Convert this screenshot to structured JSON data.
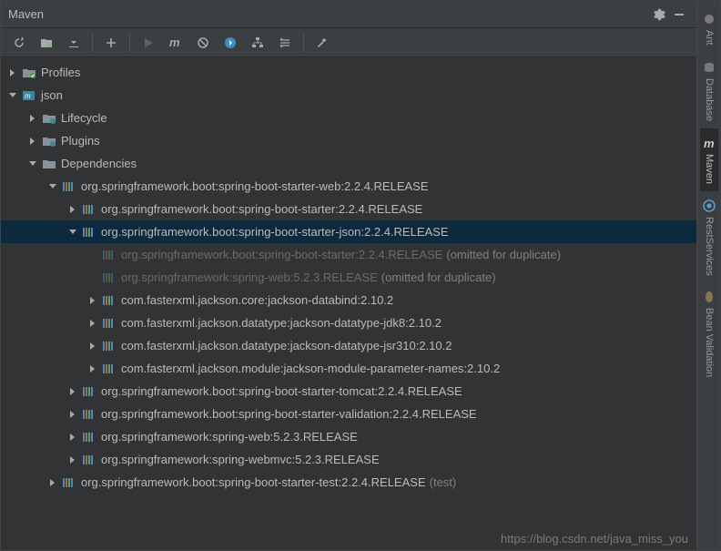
{
  "header": {
    "title": "Maven"
  },
  "sidebar": {
    "ant": "Ant",
    "database": "Database",
    "maven": "Maven",
    "restservices": "RestServices",
    "beanvalidation": "Bean Validation"
  },
  "tree": {
    "profiles": "Profiles",
    "project": "json",
    "lifecycle": "Lifecycle",
    "plugins": "Plugins",
    "dependencies": "Dependencies",
    "dep1": "org.springframework.boot:spring-boot-starter-web:2.2.4.RELEASE",
    "dep1_1": "org.springframework.boot:spring-boot-starter:2.2.4.RELEASE",
    "dep1_2": "org.springframework.boot:spring-boot-starter-json:2.2.4.RELEASE",
    "dep1_2_1": "org.springframework.boot:spring-boot-starter:2.2.4.RELEASE",
    "dep1_2_1_suffix": "(omitted for duplicate)",
    "dep1_2_2": "org.springframework:spring-web:5.2.3.RELEASE",
    "dep1_2_2_suffix": "(omitted for duplicate)",
    "dep1_2_3": "com.fasterxml.jackson.core:jackson-databind:2.10.2",
    "dep1_2_4": "com.fasterxml.jackson.datatype:jackson-datatype-jdk8:2.10.2",
    "dep1_2_5": "com.fasterxml.jackson.datatype:jackson-datatype-jsr310:2.10.2",
    "dep1_2_6": "com.fasterxml.jackson.module:jackson-module-parameter-names:2.10.2",
    "dep1_3": "org.springframework.boot:spring-boot-starter-tomcat:2.2.4.RELEASE",
    "dep1_4": "org.springframework.boot:spring-boot-starter-validation:2.2.4.RELEASE",
    "dep1_5": "org.springframework:spring-web:5.2.3.RELEASE",
    "dep1_6": "org.springframework:spring-webmvc:5.2.3.RELEASE",
    "dep2": "org.springframework.boot:spring-boot-starter-test:2.2.4.RELEASE",
    "dep2_suffix": "(test)"
  },
  "watermark": "https://blog.csdn.net/java_miss_you"
}
